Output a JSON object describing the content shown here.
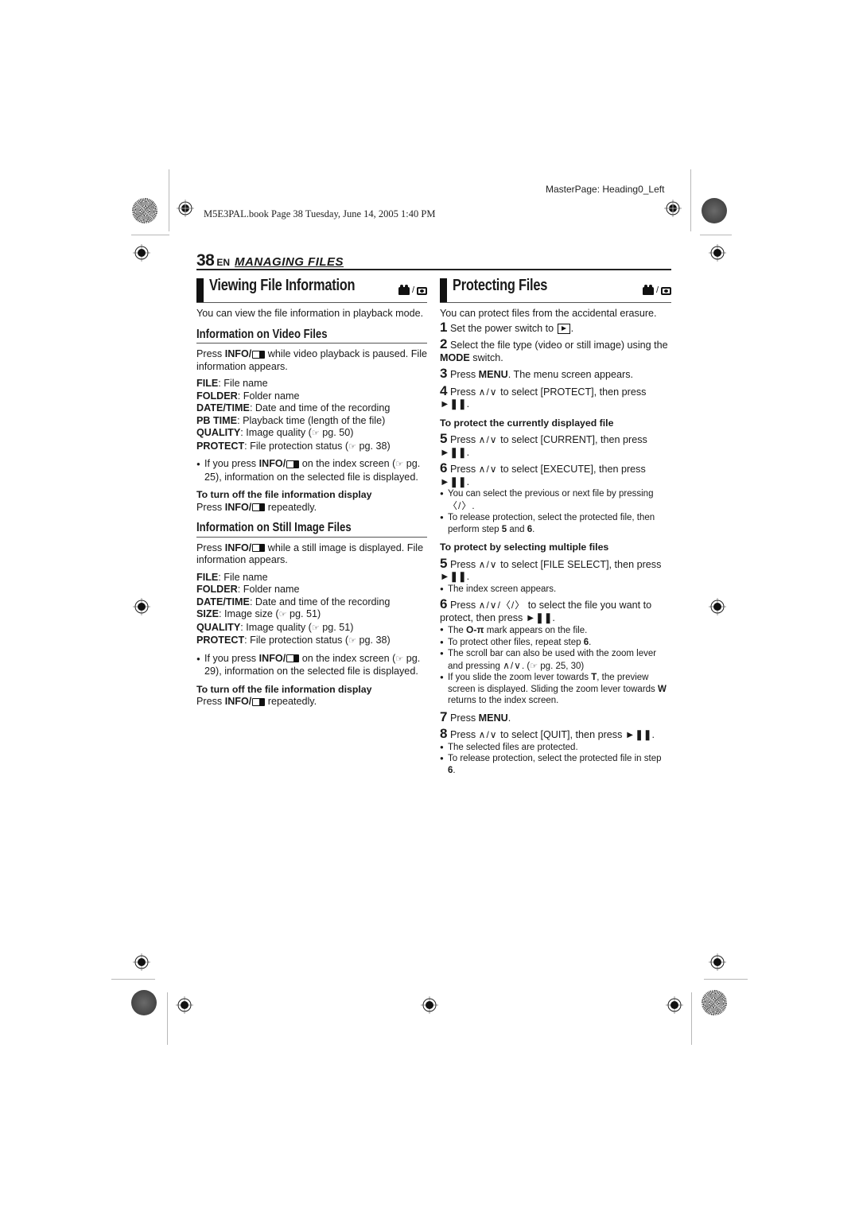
{
  "header": {
    "masterpage": "MasterPage: Heading0_Left",
    "bookline": "M5E3PAL.book  Page 38  Tuesday, June 14, 2005  1:40 PM",
    "page_number": "38",
    "lang": "EN",
    "section": "MANAGING FILES"
  },
  "left": {
    "title": "Viewing File Information",
    "intro": "You can view the file information in playback mode.",
    "video": {
      "heading": "Information on Video Files",
      "press_pre": "Press ",
      "press_key": "INFO/",
      "press_post": " while video playback is paused. File information appears.",
      "fields": [
        {
          "key": "FILE",
          "text": ": File name"
        },
        {
          "key": "FOLDER",
          "text": ": Folder name"
        },
        {
          "key": "DATE/TIME",
          "text": ": Date and time of the recording"
        },
        {
          "key": "PB TIME",
          "text": ": Playback time (length of the file)"
        },
        {
          "key": "QUALITY",
          "text": ": Image quality (",
          "ref": "pg. 50)"
        },
        {
          "key": "PROTECT",
          "text": ": File protection status (",
          "ref": "pg. 38)"
        }
      ],
      "bullet_pre": "If you press ",
      "bullet_key": "INFO/",
      "bullet_mid": " on the index screen (",
      "bullet_ref": "pg. 25), information on the selected file is displayed.",
      "turnoff_heading": "To turn off the file information display",
      "turnoff_pre": "Press ",
      "turnoff_key": "INFO/",
      "turnoff_post": " repeatedly."
    },
    "still": {
      "heading": "Information on Still Image Files",
      "press_pre": "Press ",
      "press_key": "INFO/",
      "press_post": " while a still image is displayed. File information appears.",
      "fields": [
        {
          "key": "FILE",
          "text": ": File name"
        },
        {
          "key": "FOLDER",
          "text": ": Folder name"
        },
        {
          "key": "DATE/TIME",
          "text": ": Date and time of the recording"
        },
        {
          "key": "SIZE",
          "text": ": Image size (",
          "ref": "pg. 51)"
        },
        {
          "key": "QUALITY",
          "text": ": Image quality (",
          "ref": "pg. 51)"
        },
        {
          "key": "PROTECT",
          "text": ": File protection status (",
          "ref": "pg. 38)"
        }
      ],
      "bullet_pre": "If you press ",
      "bullet_key": "INFO/",
      "bullet_mid": " on the index screen (",
      "bullet_ref": "pg. 29), information on the selected file is displayed.",
      "turnoff_heading": "To turn off the file information display",
      "turnoff_pre": "Press ",
      "turnoff_key": "INFO/",
      "turnoff_post": " repeatedly."
    }
  },
  "right": {
    "title": "Protecting Files",
    "intro": "You can protect files from the accidental erasure.",
    "steps": [
      {
        "n": "1",
        "text": "Set the power switch to"
      },
      {
        "n": "2",
        "pre": "Select the file type (video or still image) using the ",
        "key": "MODE",
        "post": " switch."
      },
      {
        "n": "3",
        "pre": "Press ",
        "key": "MENU",
        "post": ". The menu screen appears."
      },
      {
        "n": "4",
        "pre": "Press",
        "post": "to select [PROTECT], then press"
      }
    ],
    "current": {
      "heading": "To protect the currently displayed file",
      "step5": {
        "n": "5",
        "pre": "Press",
        "post": "to select [CURRENT], then press"
      },
      "step6": {
        "n": "6",
        "pre": "Press",
        "post": "to select [EXECUTE], then press"
      },
      "bullet1": "You can select the previous or next file by pressing",
      "bullet2_pre": "To release protection, select the protected file, then perform step ",
      "bullet2_n1": "5",
      "bullet2_mid": " and ",
      "bullet2_n2": "6",
      "bullet2_end": "."
    },
    "multiple": {
      "heading": "To protect by selecting multiple files",
      "step5": {
        "n": "5",
        "pre": "Press",
        "post": "to select [FILE SELECT], then press"
      },
      "step5_bullet": "The index screen appears.",
      "step6": {
        "n": "6",
        "pre": "Press",
        "post": "to select the file you want to protect, then press"
      },
      "b1_pre": "The",
      "b1_post": "mark appears on the file.",
      "b2_pre": "To protect other files, repeat step ",
      "b2_n": "6",
      "b3_pre": "The scroll bar can also be used with the zoom lever and pressing",
      "b3_ref": "pg. 25, 30)",
      "b4_pre": "If you slide the zoom lever towards ",
      "b4_T": "T",
      "b4_mid": ", the preview screen is displayed. Sliding the zoom lever towards ",
      "b4_W": "W",
      "b4_post": " returns to the index screen.",
      "step7": {
        "n": "7",
        "pre": "Press ",
        "key": "MENU",
        "post": "."
      },
      "step8": {
        "n": "8",
        "pre": "Press",
        "post": "to select [QUIT], then press"
      },
      "b5": "The selected files are protected.",
      "b6_pre": "To release protection, select the protected file in step ",
      "b6_n": "6"
    }
  },
  "icons": {
    "up_down": "∧/∨",
    "up_down_left_right": "∧/∨/〈/〉",
    "left_right": "〈/〉",
    "ref": "☞",
    "play_pause": "►❚❚",
    "key_mark": "O-π",
    "slash": "/"
  }
}
